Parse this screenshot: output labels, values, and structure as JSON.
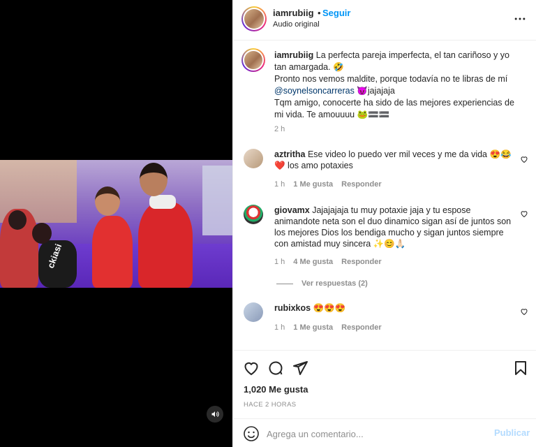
{
  "header": {
    "username": "iamrubiig",
    "dot": "•",
    "follow_label": "Seguir",
    "audio_label": "Audio original",
    "more_icon": "more-horizontal-icon"
  },
  "caption": {
    "username": "iamrubiig",
    "line1": "La perfecta pareja imperfecta, el tan cariñoso y yo tan amargada. 🤣",
    "line2": "Pronto nos vemos maldite, porque todavía no te libras de mí",
    "mention": "@soynelsoncarreras",
    "line3": "😈jajajaja",
    "line4": "Tqm amigo, conocerte ha sido de las mejores experiencias de mi vida. Te amouuuu 🐸🟰🟰",
    "time": "2 h"
  },
  "comments": [
    {
      "username": "aztritha",
      "text": "Ese video lo puedo ver mil veces y me da vida 😍😂❤️ los amo potaxies",
      "time": "1 h",
      "likes": "1 Me gusta",
      "reply": "Responder"
    },
    {
      "username": "giovamx",
      "text": "Jajajajaja tu muy potaxie jaja y tu espose animandote neta son el duo dinamico sigan así de juntos son los mejores Dios los bendiga mucho y sigan juntos siempre con amistad muy sincera ✨😊🙏🏻",
      "time": "1 h",
      "likes": "4 Me gusta",
      "reply": "Responder",
      "replies_label": "Ver respuestas (2)"
    },
    {
      "username": "rubixkos",
      "text": "😍😍😍",
      "time": "1 h",
      "likes": "1 Me gusta",
      "reply": "Responder"
    }
  ],
  "actions": {
    "likes": "1,020 Me gusta",
    "posted_ago": "HACE 2 HORAS"
  },
  "add_comment": {
    "placeholder": "Agrega un comentario...",
    "post_label": "Publicar"
  },
  "video": {
    "brand_text": "ckiasi"
  },
  "colors": {
    "link": "#0095f6",
    "mention": "#00376b",
    "muted": "#8e8e8e",
    "post_disabled": "#b3dbff"
  }
}
